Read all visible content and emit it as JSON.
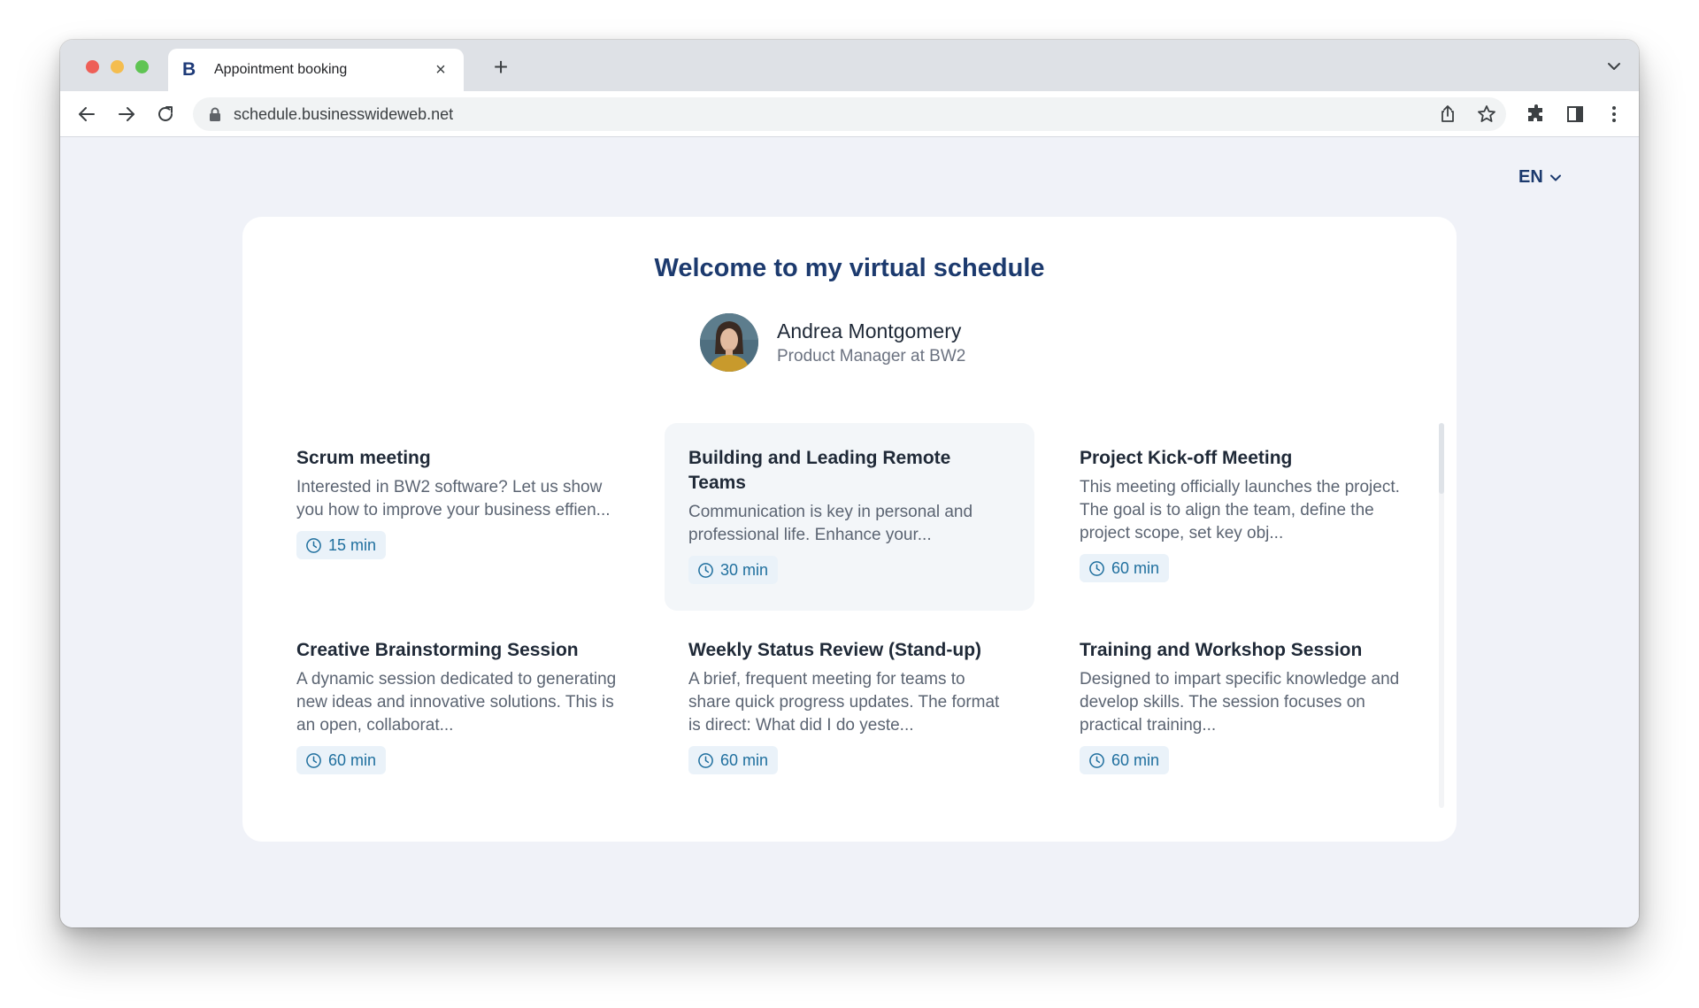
{
  "browser": {
    "tab_title": "Appointment booking",
    "tab_favicon": "B",
    "tab_close": "×",
    "new_tab": "+",
    "url": "schedule.businesswideweb.net"
  },
  "page": {
    "language": "EN",
    "welcome": "Welcome to my virtual schedule",
    "profile": {
      "name": "Andrea Montgomery",
      "role": "Product Manager at BW2"
    },
    "services": [
      {
        "title": "Scrum meeting",
        "description": "Interested in BW2 software? Let us show you how to improve your business effien...",
        "duration": "15 min"
      },
      {
        "title": "Building and Leading Remote Teams",
        "description": "Communication is key in personal and professional life. Enhance your...",
        "duration": "30 min"
      },
      {
        "title": "Project Kick-off Meeting",
        "description": "This meeting officially launches the project. The goal is to align the team, define the project scope, set key obj...",
        "duration": "60 min"
      },
      {
        "title": "Creative Brainstorming Session",
        "description": "A dynamic session dedicated to generating new ideas and innovative solutions. This is an open, collaborat...",
        "duration": "60 min"
      },
      {
        "title": "Weekly Status Review (Stand-up)",
        "description": "A brief, frequent meeting for teams to share quick progress updates. The format is direct: What did I do yeste...",
        "duration": "60 min"
      },
      {
        "title": "Training and Workshop Session",
        "description": "Designed to impart specific knowledge and develop skills. The session focuses on practical training...",
        "duration": "60 min"
      }
    ]
  },
  "colors": {
    "brand_navy": "#1c3a6e",
    "badge_bg": "#eaf2f9",
    "badge_text": "#1f6f9e",
    "page_bg": "#f0f2f8"
  }
}
